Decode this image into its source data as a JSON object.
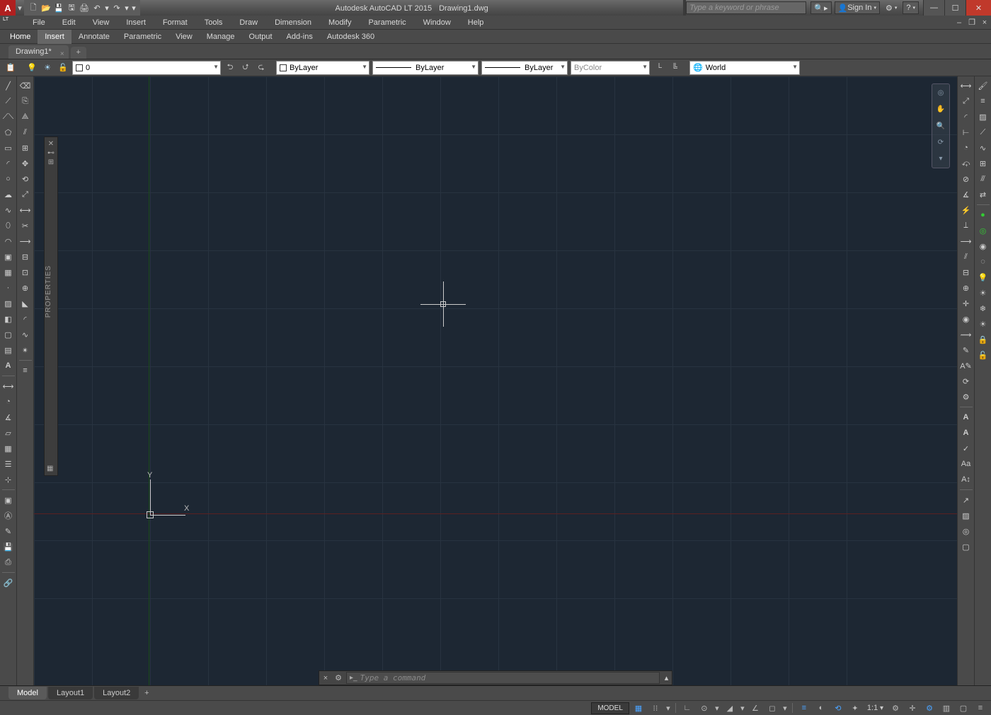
{
  "title": {
    "app": "Autodesk AutoCAD LT 2015",
    "file": "Drawing1.dwg"
  },
  "search": {
    "placeholder": "Type a keyword or phrase"
  },
  "signin": "Sign In",
  "menubar": [
    "File",
    "Edit",
    "View",
    "Insert",
    "Format",
    "Tools",
    "Draw",
    "Dimension",
    "Modify",
    "Parametric",
    "Window",
    "Help"
  ],
  "ribbon_tabs": [
    "Home",
    "Insert",
    "Annotate",
    "Parametric",
    "View",
    "Manage",
    "Output",
    "Add-ins",
    "Autodesk 360"
  ],
  "ribbon_active": 0,
  "ribbon_hover": 1,
  "file_tab": "Drawing1*",
  "layer_combo": "0",
  "linetype_combo": "ByLayer",
  "lineweight_combo": "ByLayer",
  "plotstyle_combo": "ByLayer",
  "color_combo": "ByColor",
  "ucs_combo": "World",
  "properties_palette": "PROPERTIES",
  "cmdline": {
    "placeholder": "Type a command"
  },
  "layout_tabs": [
    "Model",
    "Layout1",
    "Layout2"
  ],
  "layout_active": 0,
  "status": {
    "space": "MODEL",
    "scale": "1:1"
  },
  "ucs_labels": {
    "x": "X",
    "y": "Y"
  }
}
